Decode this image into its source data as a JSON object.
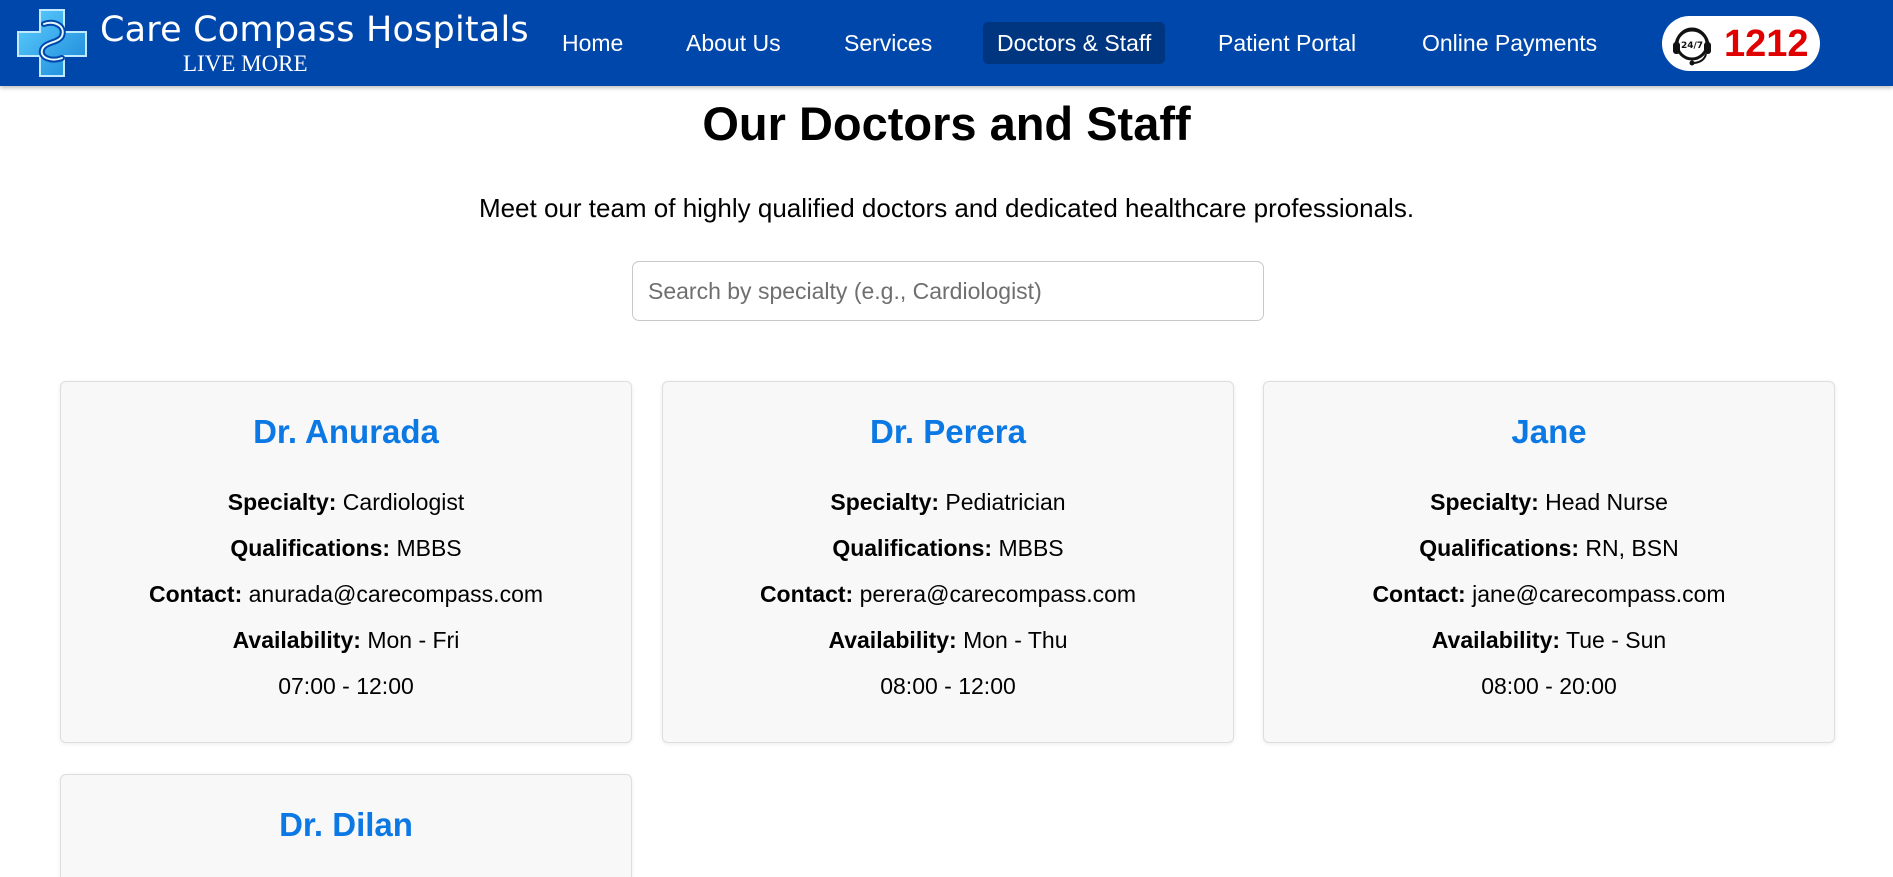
{
  "header": {
    "brand_name": "Care Compass Hospitals",
    "tagline": "LIVE MORE",
    "logo_icon": "medical-cross-logo-icon",
    "nav": [
      {
        "label": "Home",
        "active": false
      },
      {
        "label": "About Us",
        "active": false
      },
      {
        "label": "Services",
        "active": false
      },
      {
        "label": "Doctors & Staff",
        "active": true
      },
      {
        "label": "Patient Portal",
        "active": false
      },
      {
        "label": "Online Payments",
        "active": false
      }
    ],
    "hotline": {
      "icon": "24-7-support-icon",
      "icon_text": "24/7",
      "number": "1212"
    }
  },
  "main": {
    "title": "Our Doctors and Staff",
    "subtitle": "Meet our team of highly qualified doctors and dedicated healthcare professionals.",
    "search": {
      "placeholder": "Search by specialty (e.g., Cardiologist)",
      "value": ""
    },
    "field_labels": {
      "specialty": "Specialty:",
      "qualifications": "Qualifications:",
      "contact": "Contact:",
      "availability": "Availability:"
    },
    "staff": [
      {
        "name": "Dr. Anurada",
        "specialty": "Cardiologist",
        "qualifications": "MBBS",
        "contact": "anurada@carecompass.com",
        "days": "Mon - Fri",
        "hours": "07:00 - 12:00"
      },
      {
        "name": "Dr. Perera",
        "specialty": "Pediatrician",
        "qualifications": "MBBS",
        "contact": "perera@carecompass.com",
        "days": "Mon - Thu",
        "hours": "08:00 - 12:00"
      },
      {
        "name": "Jane",
        "specialty": "Head Nurse",
        "qualifications": "RN, BSN",
        "contact": "jane@carecompass.com",
        "days": "Tue - Sun",
        "hours": "08:00 - 20:00"
      },
      {
        "name": "Dr. Dilan"
      }
    ]
  },
  "colors": {
    "nav_background": "#0047ab",
    "nav_active": "#003580",
    "name_accent": "#0b78e3",
    "hotline_red": "#e00000",
    "card_background": "#f8f8f8"
  }
}
